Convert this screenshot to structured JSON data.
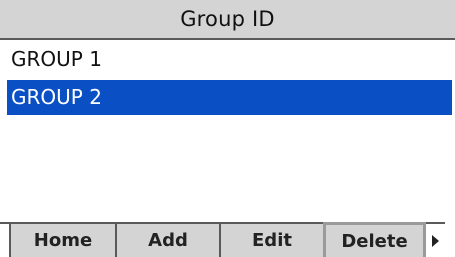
{
  "title": "Group ID",
  "list": {
    "items": [
      {
        "label": "GROUP 1",
        "selected": false
      },
      {
        "label": "GROUP 2",
        "selected": true
      }
    ]
  },
  "softkeys": {
    "home": "Home",
    "add": "Add",
    "edit": "Edit",
    "delete": "Delete",
    "more_icon": "triangle-right-icon"
  },
  "colors": {
    "selection": "#0a4fc4",
    "bar": "#d4d4d4"
  }
}
